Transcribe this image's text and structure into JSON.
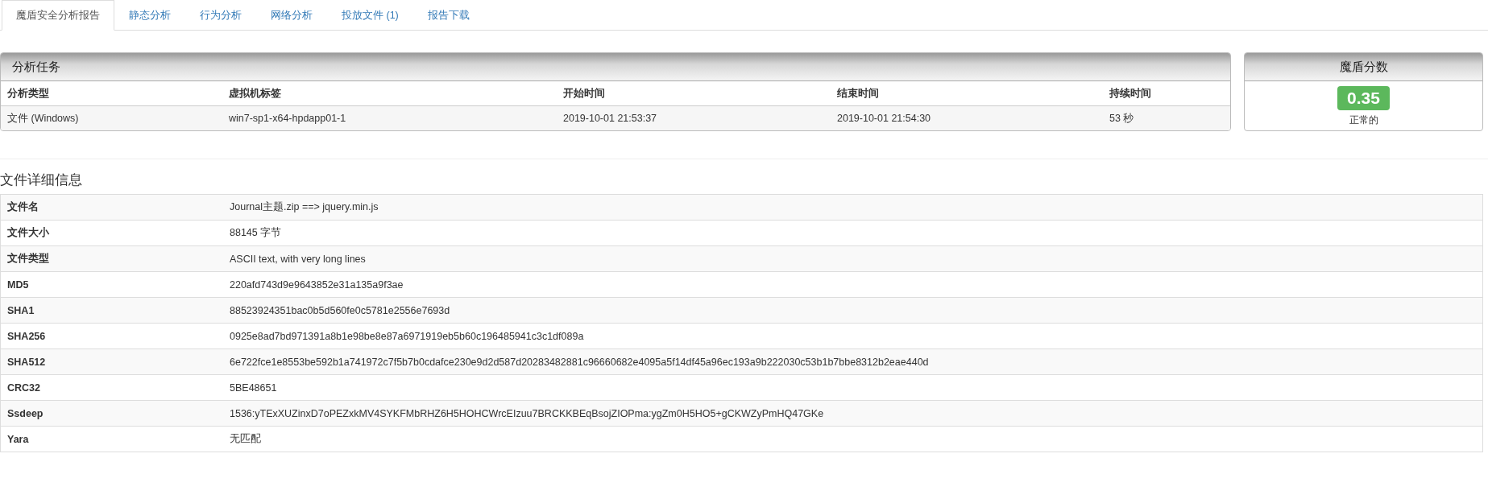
{
  "tabs": [
    {
      "label": "魔盾安全分析报告",
      "selected": true
    },
    {
      "label": "静态分析",
      "selected": false
    },
    {
      "label": "行为分析",
      "selected": false
    },
    {
      "label": "网络分析",
      "selected": false
    },
    {
      "label": "投放文件 (1)",
      "selected": false
    },
    {
      "label": "报告下载",
      "selected": false
    }
  ],
  "task_panel": {
    "title": "分析任务",
    "columns": [
      "分析类型",
      "虚拟机标签",
      "开始时间",
      "结束时间",
      "持续时间"
    ],
    "row": [
      "文件 (Windows)",
      "win7-sp1-x64-hpdapp01-1",
      "2019-10-01 21:53:37",
      "2019-10-01 21:54:30",
      "53 秒"
    ]
  },
  "score_panel": {
    "title": "魔盾分数",
    "score": "0.35",
    "verdict": "正常的"
  },
  "file_details": {
    "title": "文件详细信息",
    "rows": [
      {
        "label": "文件名",
        "value": "Journal主题.zip ==> jquery.min.js"
      },
      {
        "label": "文件大小",
        "value": "88145 字节"
      },
      {
        "label": "文件类型",
        "value": "ASCII text, with very long lines"
      },
      {
        "label": "MD5",
        "value": "220afd743d9e9643852e31a135a9f3ae"
      },
      {
        "label": "SHA1",
        "value": "88523924351bac0b5d560fe0c5781e2556e7693d"
      },
      {
        "label": "SHA256",
        "value": "0925e8ad7bd971391a8b1e98be8e87a6971919eb5b60c196485941c3c1df089a"
      },
      {
        "label": "SHA512",
        "value": "6e722fce1e8553be592b1a741972c7f5b7b0cdafce230e9d2d587d20283482881c96660682e4095a5f14df45a96ec193a9b222030c53b1b7bbe8312b2eae440d"
      },
      {
        "label": "CRC32",
        "value": "5BE48651"
      },
      {
        "label": "Ssdeep",
        "value": "1536:yTExXUZinxD7oPEZxkMV4SYKFMbRHZ6H5HOHCWrcEIzuu7BRCKKBEqBsojZIOPma:ygZm0H5HO5+gCKWZyPmHQ47GKe"
      },
      {
        "label": "Yara",
        "value": "无匹配"
      }
    ]
  }
}
